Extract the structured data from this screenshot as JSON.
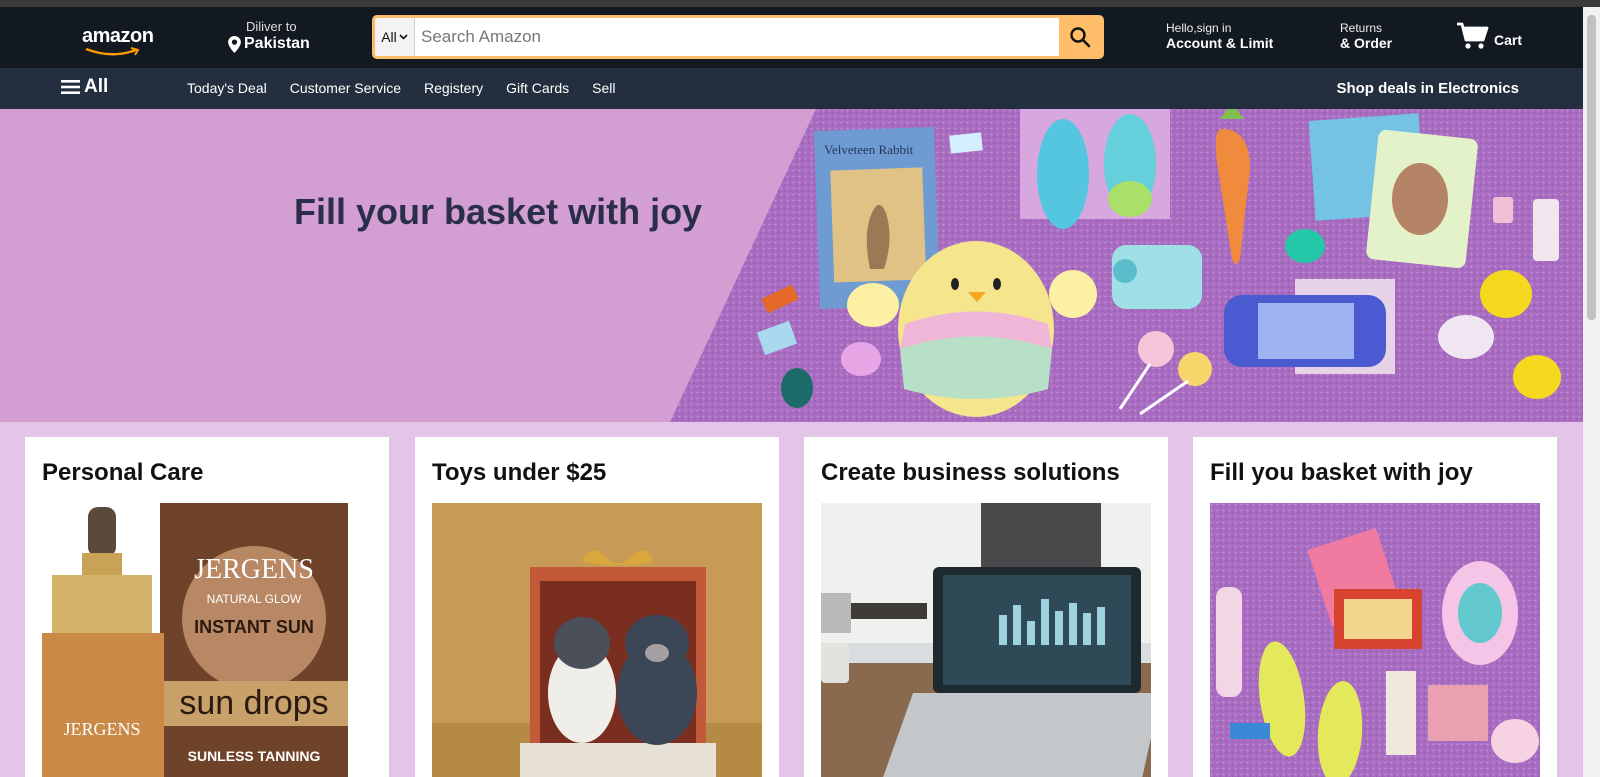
{
  "header": {
    "logo": "amazon",
    "deliver_label": "Diliver to",
    "deliver_location": "Pakistan",
    "search_category": "All",
    "search_placeholder": "Search Amazon",
    "account_line1": "Hello,sign in",
    "account_line2": "Account & Limit",
    "returns_line1": "Returns",
    "returns_line2": "& Order",
    "cart_label": "Cart"
  },
  "subnav": {
    "all_label": "All",
    "links": [
      "Today's Deal",
      "Customer Service",
      "Registery",
      "Gift Cards",
      "Sell"
    ],
    "promo": "Shop deals in Electronics"
  },
  "hero": {
    "title": "Fill your basket with joy"
  },
  "cards": [
    {
      "title": "Personal Care"
    },
    {
      "title": "Toys under $25"
    },
    {
      "title": "Create business solutions"
    },
    {
      "title": "Fill you basket with joy"
    }
  ],
  "product_text": {
    "book_title": "Velveteen Rabbit",
    "brand": "JERGENS",
    "natural_glow": "NATURAL GLOW",
    "instant_sun": "INSTANT SUN",
    "sun_drops": "sun drops",
    "sunless_tanning": "SUNLESS TANNING"
  },
  "colors": {
    "header_bg": "#131921",
    "subnav_bg": "#232f3e",
    "search_accent": "#febd69",
    "hero_bg": "#d39fd3",
    "page_bg": "#e3c5e8"
  },
  "icons": [
    "location-pin-icon",
    "chevron-down-icon",
    "search-icon",
    "cart-icon",
    "hamburger-icon"
  ]
}
